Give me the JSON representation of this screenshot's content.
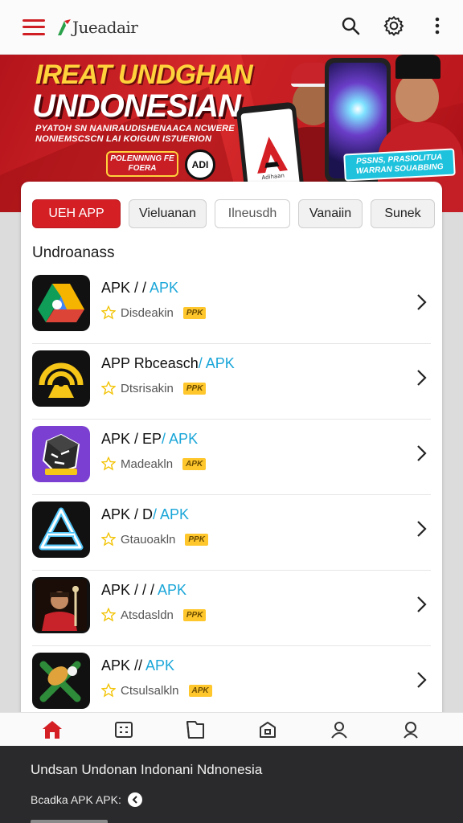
{
  "app": {
    "logo_text": "Jueadair"
  },
  "banner": {
    "title_line1": "IREAT UNDGHAN",
    "title_line2": "UNDONESIAN",
    "subtitle": "PYATOH SN NANIRAUDISHENAACA NCWERE NONIEMSCSCN LAI KOIGUN IS7UERION",
    "cta": "POLENNNNG FE FOERA",
    "badge": "ADI",
    "tag": "PSSNS, PRASIOLITUA WARRAN SOUABBING",
    "phone_label": "Adihaan"
  },
  "tabs": [
    {
      "label": "UEH APP",
      "active": true
    },
    {
      "label": "Vieluanan"
    },
    {
      "label": "Ilneusdh"
    },
    {
      "label": "Vanaiin"
    },
    {
      "label": "Sunek"
    }
  ],
  "section_title": "Undroanass",
  "apps": [
    {
      "name": "APK / / ",
      "accent": "APK",
      "dev": "Disdeakin",
      "badge": "PPK"
    },
    {
      "name": "APP Rbceasch",
      "accent": "/ APK",
      "dev": "Dtsrisakin",
      "badge": "PPK"
    },
    {
      "name": "APK / EP",
      "accent": "/ APK",
      "dev": "Madeakln",
      "badge": "APK"
    },
    {
      "name": "APK / D",
      "accent": "/ APK",
      "dev": "Gtauoakln",
      "badge": "PPK"
    },
    {
      "name": "APK / / / ",
      "accent": "APK",
      "dev": "Atsdasldn",
      "badge": "PPK"
    },
    {
      "name": "APK // ",
      "accent": "APK",
      "dev": "Ctsulsalkln",
      "badge": "APK"
    }
  ],
  "footer": {
    "title": "Undsan Undonan Indonani Ndnonesia",
    "line": "Bcadka APK APK:"
  },
  "colors": {
    "brand_red": "#d41f25",
    "accent_blue": "#1aa6d8",
    "badge_yellow": "#ffc72c"
  },
  "icons": [
    "menu-icon",
    "search-icon",
    "gear-icon",
    "more-vertical-icon",
    "home-icon",
    "grid-icon",
    "folder-icon",
    "box-icon",
    "person-icon",
    "account-icon"
  ]
}
